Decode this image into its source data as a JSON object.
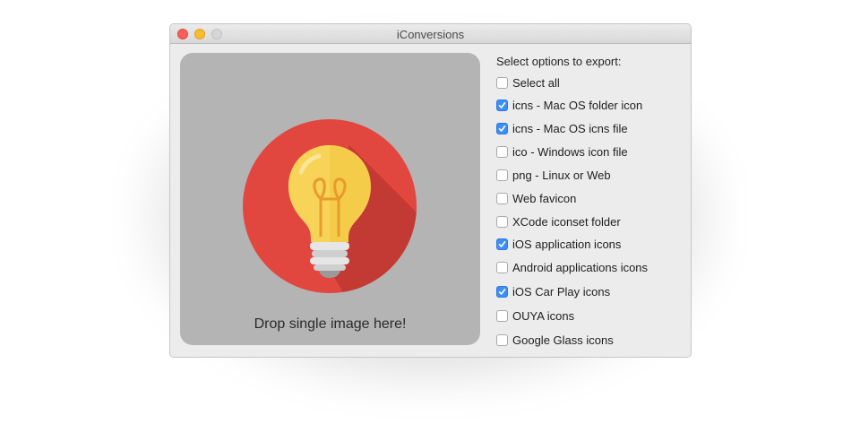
{
  "window": {
    "title": "iConversions"
  },
  "dropzone": {
    "text": "Drop single image here!",
    "image_icon": "lightbulb-icon"
  },
  "colors": {
    "circle": "#e2473f",
    "bulb": "#f5cc4a",
    "check_accent": "#3d8ef8"
  },
  "options": {
    "heading": "Select options to export:",
    "items": [
      {
        "label": "Select all",
        "checked": false
      },
      {
        "label": "icns - Mac OS folder icon",
        "checked": true
      },
      {
        "label": "icns - Mac OS icns file",
        "checked": true
      },
      {
        "label": "ico - Windows icon file",
        "checked": false
      },
      {
        "label": "png - Linux or Web",
        "checked": false
      },
      {
        "label": "Web favicon",
        "checked": false
      },
      {
        "label": "XCode iconset folder",
        "checked": false
      },
      {
        "label": "iOS application icons",
        "checked": true
      },
      {
        "label": "Android applications icons",
        "checked": false
      },
      {
        "label": "iOS Car Play icons",
        "checked": true
      },
      {
        "label": "OUYA icons",
        "checked": false
      },
      {
        "label": "Google Glass icons",
        "checked": false
      }
    ]
  }
}
